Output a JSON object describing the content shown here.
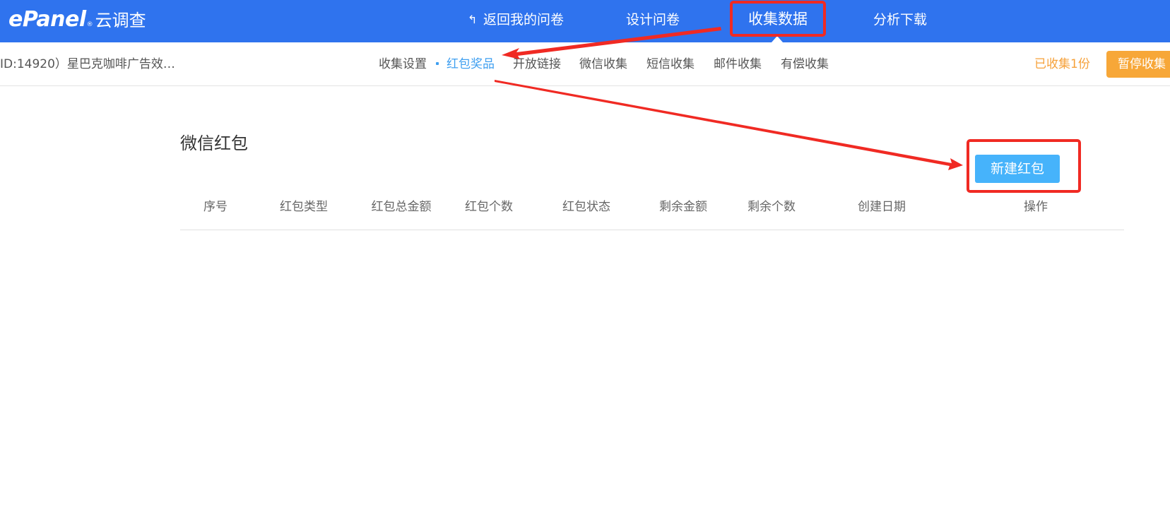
{
  "brand": {
    "mark": "ePanel",
    "registered": "®",
    "name_cn": "云调查"
  },
  "topnav": {
    "back_icon": "↰",
    "back_label": "返回我的问卷",
    "design_label": "设计问卷",
    "collect_label": "收集数据",
    "analysis_label": "分析下载"
  },
  "subbar": {
    "survey_title": "ID:14920）星巴克咖啡广告效…",
    "tabs": [
      {
        "label": "收集设置"
      },
      {
        "label": "红包奖品"
      },
      {
        "label": "开放链接"
      },
      {
        "label": "微信收集"
      },
      {
        "label": "短信收集"
      },
      {
        "label": "邮件收集"
      },
      {
        "label": "有偿收集"
      }
    ],
    "collected": "已收集1份",
    "pause_label": "暂停收集"
  },
  "content": {
    "title": "微信红包",
    "new_button": "新建红包",
    "columns": [
      "序号",
      "红包类型",
      "红包总金额",
      "红包个数",
      "红包状态",
      "剩余金额",
      "剩余个数",
      "创建日期",
      "操作"
    ]
  },
  "colors": {
    "topbar": "#2f73ee",
    "accent_blue": "#3f9ff0",
    "orange": "#f7a738",
    "annotation_red": "#f02a23"
  }
}
